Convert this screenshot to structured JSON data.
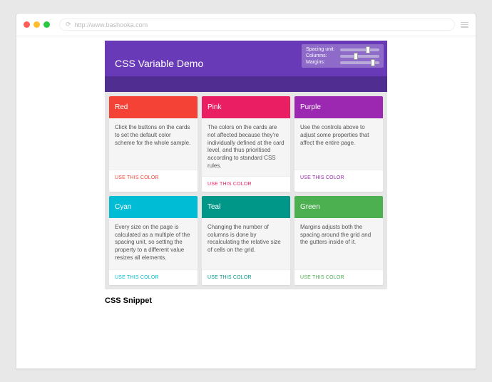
{
  "browser": {
    "url": "http://www.bashooka.com"
  },
  "demo": {
    "title": "CSS Variable Demo",
    "controls": {
      "spacing": {
        "label": "Spacing unit:",
        "thumb_pct": 65
      },
      "columns": {
        "label": "Columns:",
        "thumb_pct": 35
      },
      "margins": {
        "label": "Margins:",
        "thumb_pct": 78
      }
    },
    "action_label": "USE THIS COLOR",
    "cards": [
      {
        "name": "Red",
        "bg": "#f44336",
        "action": "#f44336",
        "body": "Click the buttons on the cards to set the default color scheme for the whole sample."
      },
      {
        "name": "Pink",
        "bg": "#e91e63",
        "action": "#e91e63",
        "body": "The colors on the cards are not affected because they're individually defined at the card level, and thus prioritised according to standard CSS rules."
      },
      {
        "name": "Purple",
        "bg": "#9c27b0",
        "action": "#9c27b0",
        "body": "Use the controls above to adjust some properties that affect the entire page."
      },
      {
        "name": "Cyan",
        "bg": "#00bcd4",
        "action": "#00bcd4",
        "body": "Every size on the page is calculated as a multiple of the spacing unit, so setting the property to a different value resizes all elements."
      },
      {
        "name": "Teal",
        "bg": "#009688",
        "action": "#009688",
        "body": "Changing the number of columns is done by recalculating the relative size of cells on the grid."
      },
      {
        "name": "Green",
        "bg": "#4caf50",
        "action": "#4caf50",
        "body": "Margins adjusts both the spacing around the grid and the gutters inside of it."
      }
    ]
  },
  "heading": "CSS Snippet"
}
